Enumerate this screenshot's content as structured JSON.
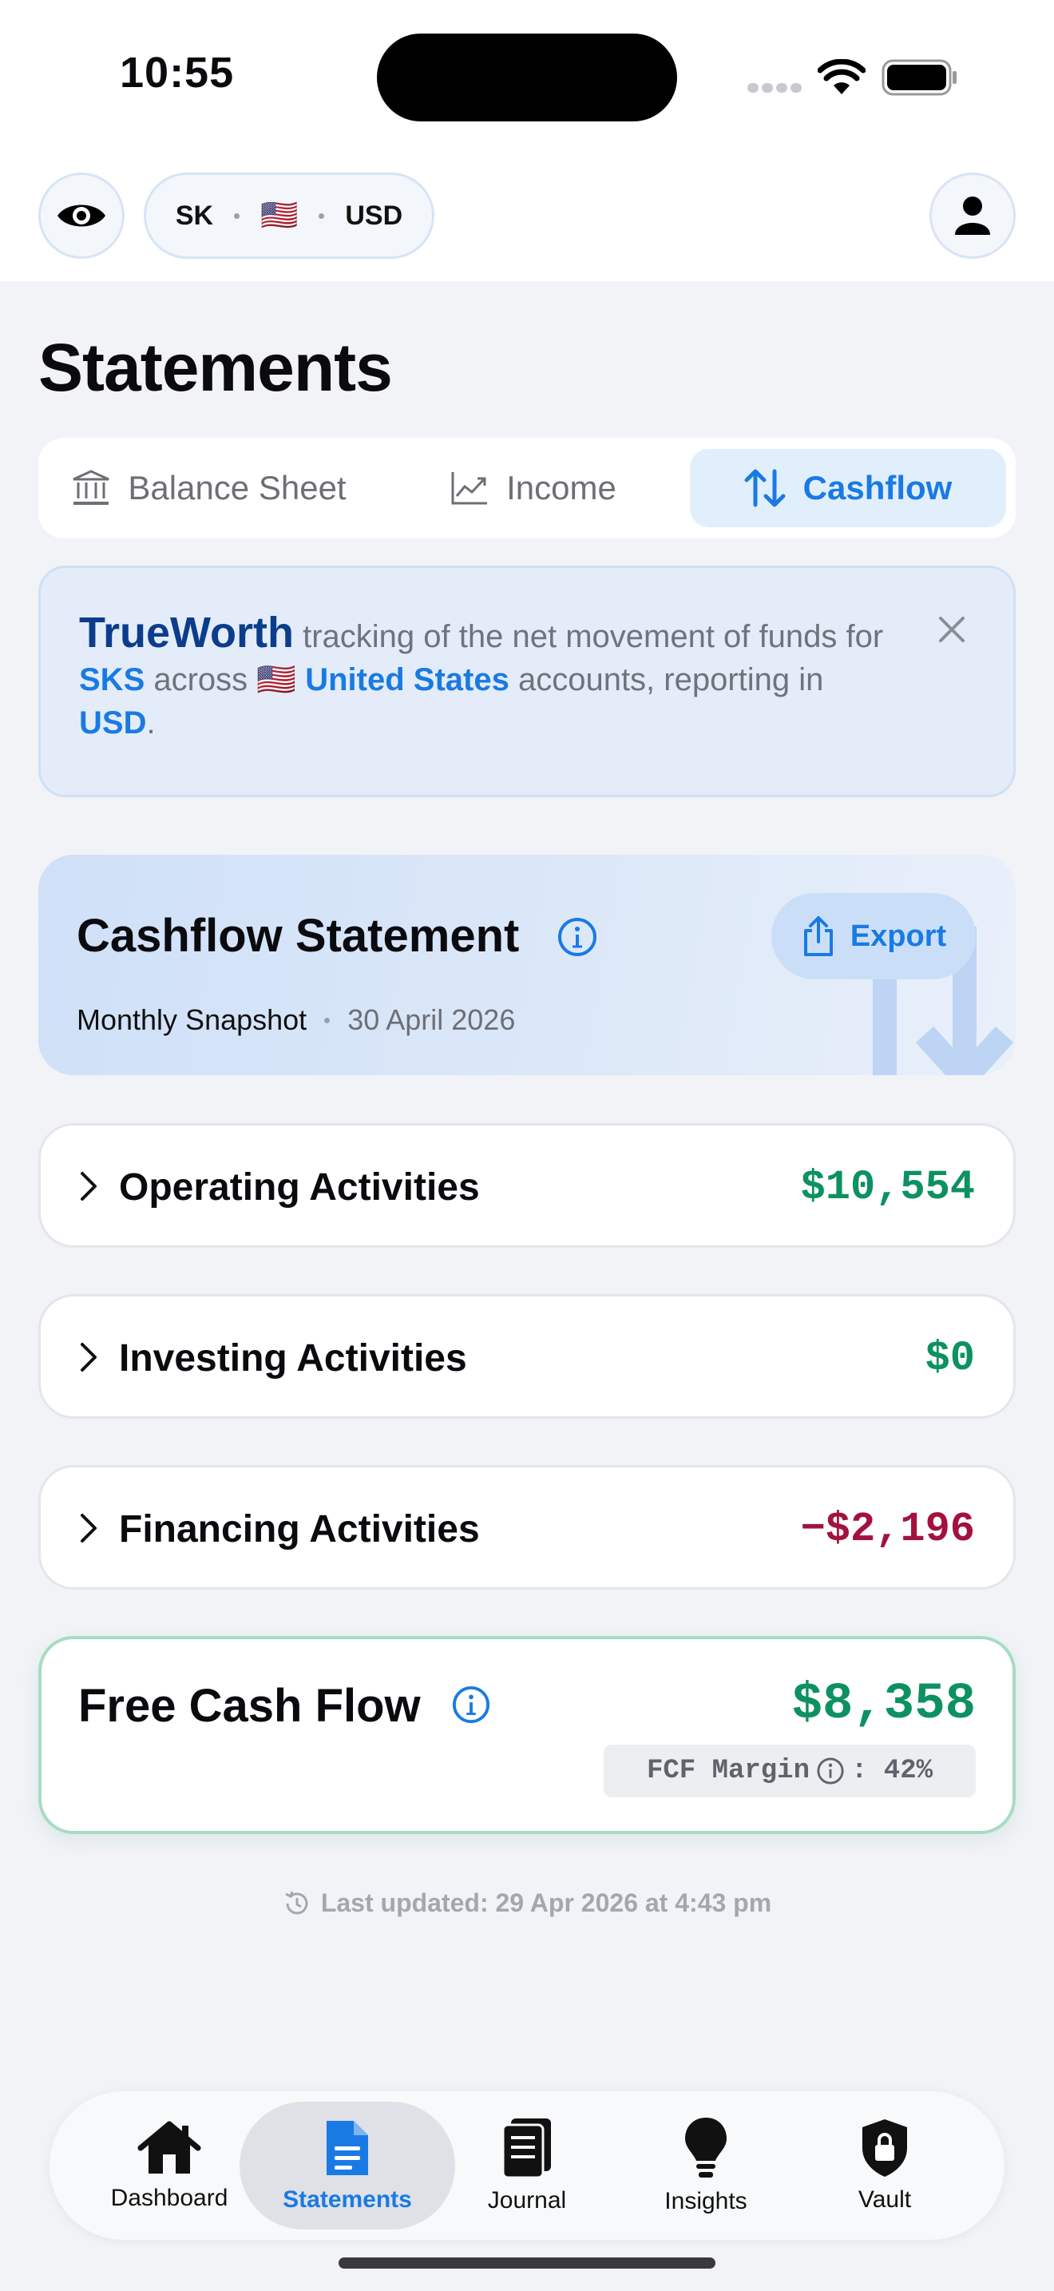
{
  "status_bar": {
    "time": "10:55"
  },
  "header": {
    "profile_code": "SK",
    "country_flag": "🇺🇸",
    "currency": "USD"
  },
  "page_title": "Statements",
  "tabs": [
    {
      "label": "Balance Sheet",
      "icon": "bank-icon",
      "active": false
    },
    {
      "label": "Income",
      "icon": "line-chart-icon",
      "active": false
    },
    {
      "label": "Cashflow",
      "icon": "arrows-up-down-icon",
      "active": true
    }
  ],
  "banner": {
    "brand": "TrueWorth",
    "text1": " tracking of the net movement of funds for ",
    "entity": "SKS",
    "text2": " across ",
    "flag": "🇺🇸",
    "country": "United States",
    "text3": " accounts, reporting in ",
    "currency": "USD",
    "text4": "."
  },
  "statement": {
    "title": "Cashflow Statement",
    "period": "Monthly Snapshot",
    "date": "30 April 2026",
    "export_label": "Export"
  },
  "activities": [
    {
      "label": "Operating Activities",
      "value": "$10,554",
      "sign": "positive"
    },
    {
      "label": "Investing Activities",
      "value": "$0",
      "sign": "positive"
    },
    {
      "label": "Financing Activities",
      "value": "−$2,196",
      "sign": "negative"
    }
  ],
  "free_cash_flow": {
    "title": "Free Cash Flow",
    "value": "$8,358",
    "margin_label": "FCF Margin",
    "margin_value": ": 42%"
  },
  "last_updated": "Last updated: 29 Apr 2026 at 4:43 pm",
  "tab_bar": [
    {
      "label": "Dashboard",
      "icon": "house-icon",
      "active": false
    },
    {
      "label": "Statements",
      "icon": "document-icon",
      "active": true
    },
    {
      "label": "Journal",
      "icon": "journal-icon",
      "active": false
    },
    {
      "label": "Insights",
      "icon": "lightbulb-icon",
      "active": false
    },
    {
      "label": "Vault",
      "icon": "shield-lock-icon",
      "active": false
    }
  ],
  "colors": {
    "accent": "#1a7ae3",
    "positive": "#0d9160",
    "negative": "#a3123c",
    "brand": "#0b3d8c"
  }
}
